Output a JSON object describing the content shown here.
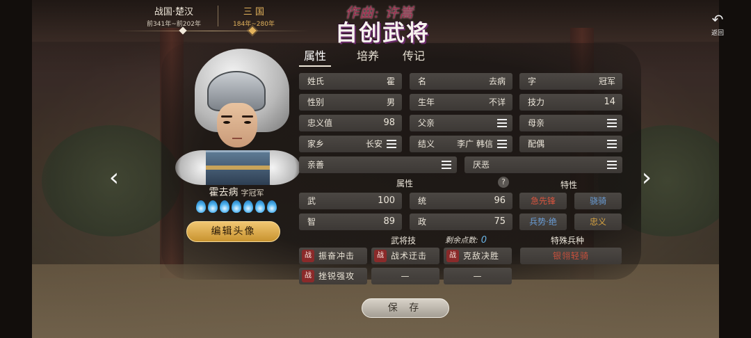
{
  "eras": [
    {
      "name": "战国·楚汉",
      "years": "前341年~前202年"
    },
    {
      "name": "三 国",
      "years": "184年~280年"
    }
  ],
  "active_era": 1,
  "composer": "作曲: 许嵩",
  "title": "自创武将",
  "back": {
    "label": "返回",
    "icon": "back-arrow-icon"
  },
  "nav": {
    "prev": "‹",
    "next": "›"
  },
  "character": {
    "name": "霍去病",
    "courtesy": "字冠军",
    "star_count": 7,
    "edit_portrait_label": "编辑头像"
  },
  "tabs": [
    {
      "label": "属性"
    },
    {
      "label": "培养"
    },
    {
      "label": "传记"
    }
  ],
  "active_tab": 0,
  "fields": {
    "surname": {
      "k": "姓氏",
      "v": "霍"
    },
    "given_name": {
      "k": "名",
      "v": "去病"
    },
    "courtesy_name": {
      "k": "字",
      "v": "冠军"
    },
    "gender": {
      "k": "性别",
      "v": "男"
    },
    "birth_year": {
      "k": "生年",
      "v": "不详"
    },
    "skill_power": {
      "k": "技力",
      "v": "14"
    },
    "loyalty": {
      "k": "忠义值",
      "v": "98"
    },
    "father": {
      "k": "父亲",
      "v": ""
    },
    "mother": {
      "k": "母亲",
      "v": ""
    },
    "hometown": {
      "k": "家乡",
      "v": "长安"
    },
    "sworn": {
      "k": "结义",
      "v": "李广 韩信"
    },
    "spouse": {
      "k": "配偶",
      "v": ""
    },
    "likes": {
      "k": "亲善",
      "v": ""
    },
    "dislikes": {
      "k": "厌恶",
      "v": ""
    }
  },
  "attributes": {
    "header": "属性",
    "help": "?",
    "war": {
      "k": "武",
      "v": "100"
    },
    "command": {
      "k": "统",
      "v": "96"
    },
    "intellect": {
      "k": "智",
      "v": "89"
    },
    "politics": {
      "k": "政",
      "v": "75"
    }
  },
  "traits": {
    "header": "特性",
    "items": [
      {
        "label": "急先锋",
        "color": "#d8543e"
      },
      {
        "label": "骁骑",
        "color": "#6a9ed8"
      },
      {
        "label": "兵势·绝",
        "color": "#6a9ed8"
      },
      {
        "label": "忠义",
        "color": "#d9a441"
      }
    ]
  },
  "skills": {
    "header": "武将技",
    "remaining_label": "剩余点数:",
    "remaining_value": "0",
    "badge": "战",
    "items": [
      {
        "label": "振奋冲击"
      },
      {
        "label": "战术迂击"
      },
      {
        "label": "克敌决胜"
      },
      {
        "label": "挫锐强攻"
      },
      {
        "label": "—"
      },
      {
        "label": "—"
      }
    ]
  },
  "troop": {
    "header": "特殊兵种",
    "label": "银翎轻骑"
  },
  "save_label": "保 存",
  "colors": {
    "accent": "#e3b35c",
    "badge": "#8a2a2a",
    "star": "#4fb3f0",
    "remaining": "#6ab4e6"
  }
}
